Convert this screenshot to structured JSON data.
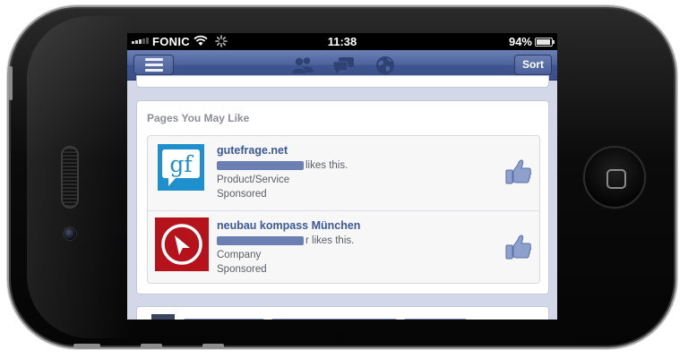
{
  "statusbar": {
    "carrier": "FONIC",
    "time": "11:38",
    "battery": "94%",
    "battery_level": 0.94
  },
  "navbar": {
    "sort_label": "Sort",
    "icons": [
      "friend-requests-icon",
      "messages-icon",
      "notifications-globe-icon"
    ]
  },
  "pymk": {
    "title": "Pages You May Like",
    "pages": [
      {
        "name": "gutefrage.net",
        "likes_suffix": "likes this.",
        "category": "Product/Service",
        "sponsored": "Sponsored",
        "logo_text": "gf",
        "logo_color": "#1f8fce"
      },
      {
        "name": "neubau kompass München",
        "likes_suffix": "r likes this.",
        "category": "Company",
        "sponsored": "Sponsored",
        "logo_color": "#c8141c"
      }
    ]
  },
  "colors": {
    "nav_blue": "#3b5998",
    "link_blue": "#3b5998",
    "feed_bg": "#d3d8e8"
  }
}
